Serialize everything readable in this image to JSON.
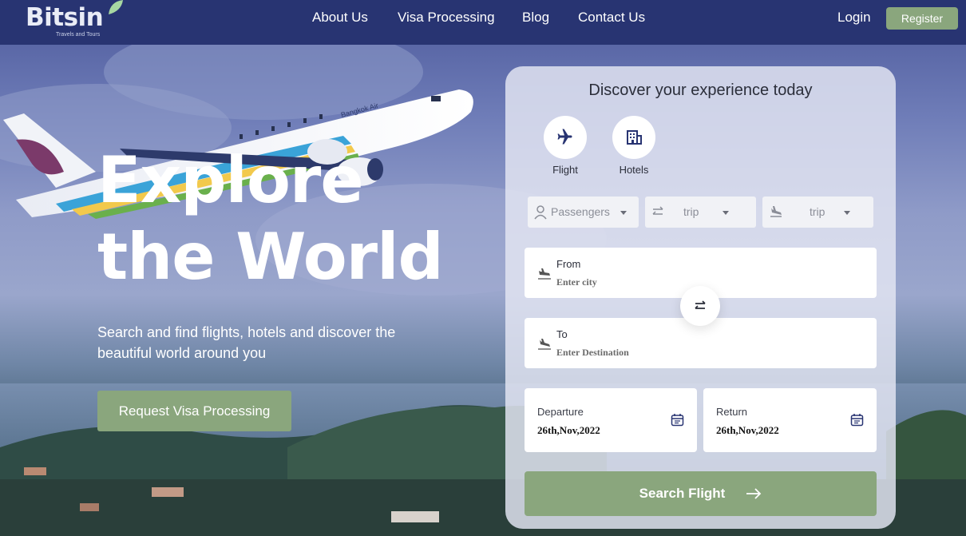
{
  "brand": {
    "name": "Bitsin",
    "tagline": "Travels and Tours"
  },
  "nav": {
    "links": [
      "About Us",
      "Visa Processing",
      "Blog",
      "Contact Us"
    ],
    "login_label": "Login",
    "register_label": "Register"
  },
  "hero": {
    "headline_line1": "Explore",
    "headline_line2": "the World",
    "subtext": "Search and find flights, hotels and discover the beautiful world around you",
    "cta_label": "Request Visa Processing",
    "plane_livery": "Bangkok Air"
  },
  "booking": {
    "title": "Discover your experience today",
    "modes": [
      {
        "label": "Flight",
        "icon": "airplane-icon"
      },
      {
        "label": "Hotels",
        "icon": "hotel-building-icon"
      }
    ],
    "dropdowns": [
      {
        "value": "Passengers",
        "icon": "person-icon"
      },
      {
        "value": "trip",
        "icon": "swap-arrows-icon"
      },
      {
        "value": "trip",
        "icon": "plane-landing-icon"
      }
    ],
    "from": {
      "label": "From",
      "placeholder": "Enter city"
    },
    "to": {
      "label": "To",
      "placeholder": "Enter Destination"
    },
    "departure": {
      "label": "Departure",
      "value": "26th,Nov,2022"
    },
    "return": {
      "label": "Return",
      "value": "26th,Nov,2022"
    },
    "search_label": "Search Flight"
  },
  "colors": {
    "header_bg": "#283472",
    "accent_green": "#8aa67d",
    "card_bg": "#e2e5f2"
  }
}
